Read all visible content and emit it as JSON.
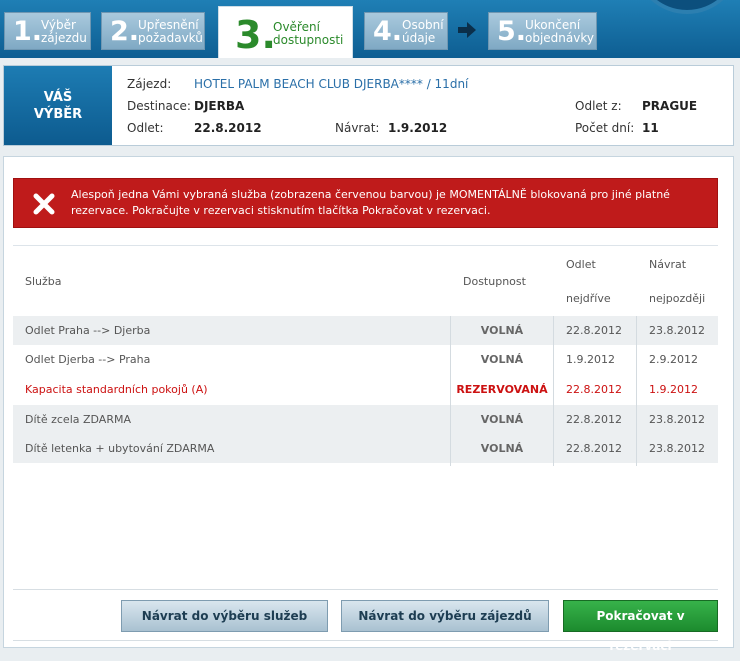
{
  "steps": [
    {
      "num": "1.",
      "label1": "Výběr",
      "label2": "zájezdu"
    },
    {
      "num": "2.",
      "label1": "Upřesnění",
      "label2": "požadavků"
    },
    {
      "num": "3.",
      "label1": "Ověření",
      "label2": "dostupnosti"
    },
    {
      "num": "4.",
      "label1": "Osobní",
      "label2": "údaje"
    },
    {
      "num": "5.",
      "label1": "Ukončení",
      "label2": "objednávky"
    }
  ],
  "selection": {
    "tab_line1": "VÁŠ",
    "tab_line2": "VÝBĚR",
    "zajezd_label": "Zájezd:",
    "zajezd_value": "HOTEL PALM BEACH CLUB DJERBA**** / 11dní",
    "destinace_label": "Destinace:",
    "destinace_value": "DJERBA",
    "odlet_label": "Odlet:",
    "odlet_value": "22.8.2012",
    "navrat_label": "Návrat:",
    "navrat_value": "1.9.2012",
    "odlet_z_label": "Odlet z:",
    "odlet_z_value": "PRAGUE",
    "pocet_dni_label": "Počet dní:",
    "pocet_dni_value": "11"
  },
  "alert": {
    "line1": "Alespoň jedna Vámi vybraná služba (zobrazena červenou barvou) je MOMENTÁLNĚ blokovaná pro jiné platné",
    "line2": "rezervace.  Pokračujte v rezervaci stisknutím tlačítka Pokračovat v rezervaci."
  },
  "table": {
    "headers": {
      "sluzba": "Služba",
      "dostupnost": "Dostupnost",
      "odlet": "Odlet",
      "odlet_sub": "nejdříve",
      "navrat": "Návrat",
      "navrat_sub": "nejpozději"
    },
    "rows": [
      {
        "sluzba": "Odlet Praha --> Djerba",
        "dostupnost": "VOLNÁ",
        "odlet": "22.8.2012",
        "navrat": "23.8.2012"
      },
      {
        "sluzba": "Odlet Djerba --> Praha",
        "dostupnost": "VOLNÁ",
        "odlet": "1.9.2012",
        "navrat": "2.9.2012"
      },
      {
        "sluzba": "Kapacita standardních pokojů (A)",
        "dostupnost": "REZERVOVANÁ",
        "odlet": "22.8.2012",
        "navrat": "1.9.2012"
      },
      {
        "sluzba": "Dítě zcela ZDARMA",
        "dostupnost": "VOLNÁ",
        "odlet": "22.8.2012",
        "navrat": "23.8.2012"
      },
      {
        "sluzba": "Dítě letenka + ubytování ZDARMA",
        "dostupnost": "VOLNÁ",
        "odlet": "22.8.2012",
        "navrat": "23.8.2012"
      }
    ]
  },
  "buttons": {
    "back_services": "Návrat do výběru služeb",
    "back_tours": "Návrat do výběru zájezdů",
    "continue": "Pokračovat v rezervaci"
  },
  "colors": {
    "brand_blue": "#0e5e92",
    "active_green": "#2b8a2b",
    "alert_red": "#bf1b1b",
    "reserved_red": "#cc1111",
    "continue_green": "#1c8b2e"
  },
  "icons": {
    "step_arrow": "arrow-right-icon",
    "alert": "close-x-icon",
    "clock": "clock-icon"
  }
}
